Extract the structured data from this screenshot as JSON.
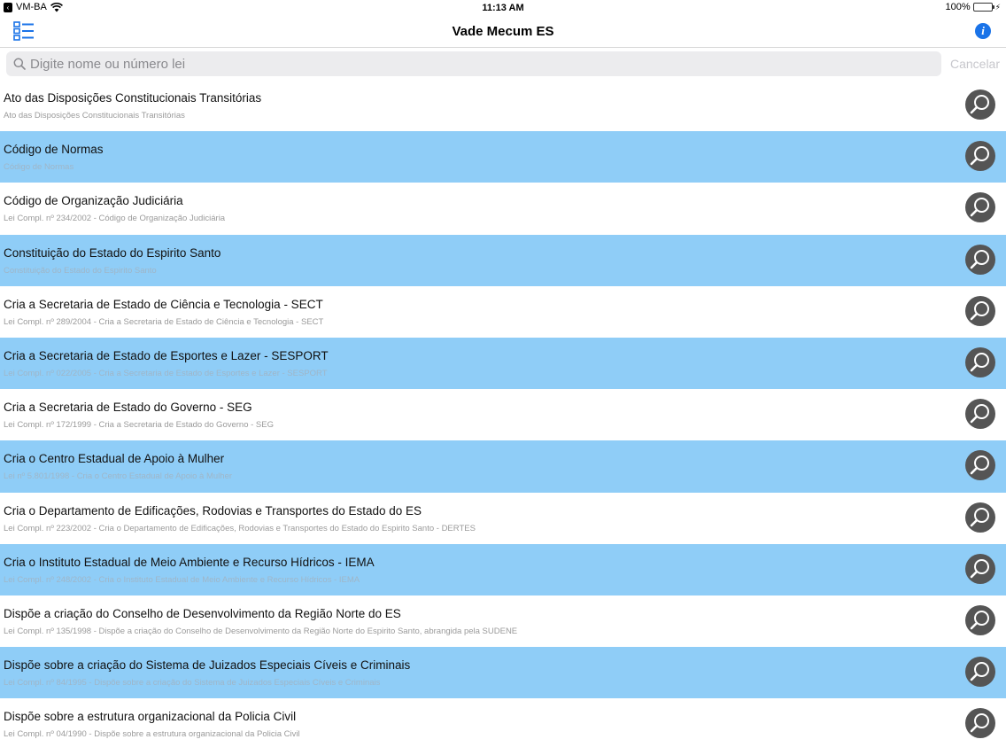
{
  "status_bar": {
    "carrier": "VM-BA",
    "time": "11:13 AM",
    "battery": "100%"
  },
  "nav": {
    "title": "Vade Mecum ES",
    "menu_icon": "list-icon",
    "info_icon": "info-icon",
    "info_glyph": "i"
  },
  "search": {
    "placeholder": "Digite nome ou número lei",
    "cancel_label": "Cancelar"
  },
  "colors": {
    "alt_row": "#8fcdf7",
    "accent": "#1a73e8",
    "button": "#555555"
  },
  "items": [
    {
      "title": "Ato das Disposições Constitucionais Transitórias",
      "subtitle": "Ato das Disposições Constitucionais Transitórias"
    },
    {
      "title": "Código de Normas",
      "subtitle": "Código de Normas"
    },
    {
      "title": "Código de Organização Judiciária",
      "subtitle": "Lei Compl. nº 234/2002 - Código de Organização Judiciária"
    },
    {
      "title": "Constituição do Estado do Espirito Santo",
      "subtitle": "Constituição do Estado do Espirito Santo"
    },
    {
      "title": "Cria a Secretaria de Estado de Ciência e Tecnologia - SECT",
      "subtitle": "Lei Compl. nº 289/2004 - Cria a Secretaria de Estado de Ciência e Tecnologia - SECT"
    },
    {
      "title": "Cria a Secretaria de Estado de Esportes e Lazer - SESPORT",
      "subtitle": "Lei Compl. nº 022/2005 - Cria a Secretaria de Estado de Esportes e Lazer - SESPORT"
    },
    {
      "title": "Cria a Secretaria de Estado do Governo - SEG",
      "subtitle": "Lei Compl. nº 172/1999 - Cria a Secretaria de Estado do Governo - SEG"
    },
    {
      "title": "Cria o Centro Estadual de Apoio à Mulher",
      "subtitle": "Lei nº 5.801/1998 - Cria o Centro Estadual de Apoio à Mulher"
    },
    {
      "title": "Cria o Departamento de Edificações, Rodovias e Transportes do Estado do ES",
      "subtitle": "Lei Compl. nº 223/2002 - Cria o Departamento de Edificações, Rodovias e Transportes do Estado do Espirito Santo - DERTES"
    },
    {
      "title": "Cria o Instituto Estadual de Meio Ambiente e Recurso Hídricos - IEMA",
      "subtitle": "Lei Compl. nº 248/2002 - Cria o Instituto Estadual de Meio Ambiente e Recurso Hídricos - IEMA"
    },
    {
      "title": "Dispõe a criação do Conselho de Desenvolvimento da Região Norte do ES",
      "subtitle": "Lei Compl. nº 135/1998 - Dispõe a criação do Conselho de Desenvolvimento da Região Norte do Espirito Santo, abrangida pela SUDENE"
    },
    {
      "title": "Dispõe sobre a criação do Sistema de Juizados Especiais Cíveis e Criminais",
      "subtitle": "Lei Compl. nº 84/1995 - Dispõe sobre a criação do Sistema de Juizados Especiais Cíveis e Criminais"
    },
    {
      "title": "Dispõe sobre a estrutura organizacional da Policia Civil",
      "subtitle": "Lei Compl. nº 04/1990 - Dispõe sobre a estrutura organizacional da Policia Civil"
    }
  ]
}
